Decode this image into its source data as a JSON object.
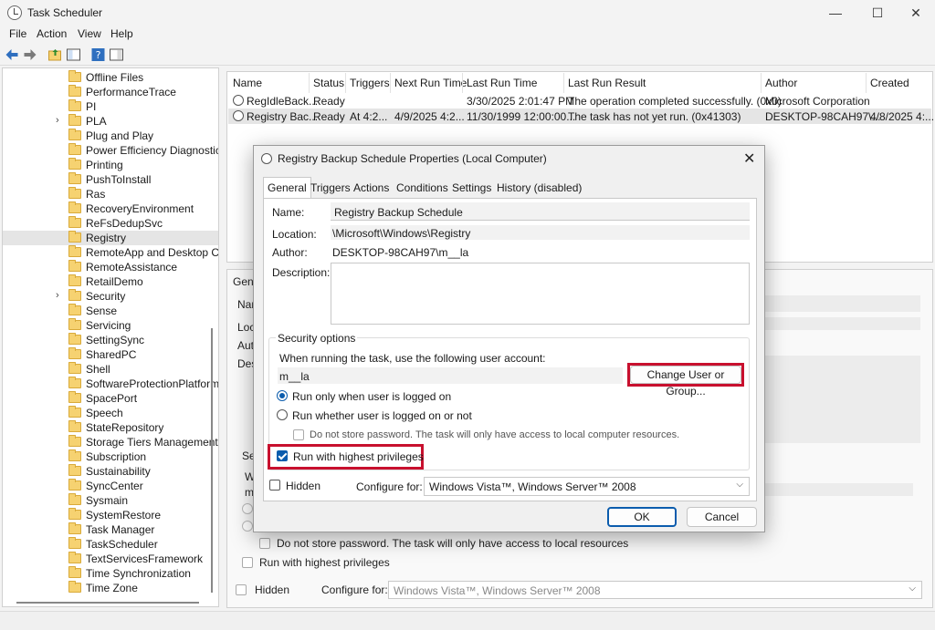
{
  "window": {
    "title": "Task Scheduler"
  },
  "window_controls": {
    "minimize": "—",
    "maximize": "☐",
    "close": "✕"
  },
  "menu": [
    "File",
    "Action",
    "View",
    "Help"
  ],
  "tree": {
    "selected": "Registry",
    "items": [
      {
        "label": "Offline Files",
        "expandable": false
      },
      {
        "label": "PerformanceTrace",
        "expandable": false
      },
      {
        "label": "PI",
        "expandable": false
      },
      {
        "label": "PLA",
        "expandable": true
      },
      {
        "label": "Plug and Play",
        "expandable": false
      },
      {
        "label": "Power Efficiency Diagnostics",
        "expandable": false
      },
      {
        "label": "Printing",
        "expandable": false
      },
      {
        "label": "PushToInstall",
        "expandable": false
      },
      {
        "label": "Ras",
        "expandable": false
      },
      {
        "label": "RecoveryEnvironment",
        "expandable": false
      },
      {
        "label": "ReFsDedupSvc",
        "expandable": false
      },
      {
        "label": "Registry",
        "expandable": false
      },
      {
        "label": "RemoteApp and Desktop Co",
        "expandable": false
      },
      {
        "label": "RemoteAssistance",
        "expandable": false
      },
      {
        "label": "RetailDemo",
        "expandable": false
      },
      {
        "label": "Security",
        "expandable": true
      },
      {
        "label": "Sense",
        "expandable": false
      },
      {
        "label": "Servicing",
        "expandable": false
      },
      {
        "label": "SettingSync",
        "expandable": false
      },
      {
        "label": "SharedPC",
        "expandable": false
      },
      {
        "label": "Shell",
        "expandable": false
      },
      {
        "label": "SoftwareProtectionPlatform",
        "expandable": false
      },
      {
        "label": "SpacePort",
        "expandable": false
      },
      {
        "label": "Speech",
        "expandable": false
      },
      {
        "label": "StateRepository",
        "expandable": false
      },
      {
        "label": "Storage Tiers Management",
        "expandable": false
      },
      {
        "label": "Subscription",
        "expandable": false
      },
      {
        "label": "Sustainability",
        "expandable": false
      },
      {
        "label": "SyncCenter",
        "expandable": false
      },
      {
        "label": "Sysmain",
        "expandable": false
      },
      {
        "label": "SystemRestore",
        "expandable": false
      },
      {
        "label": "Task Manager",
        "expandable": false
      },
      {
        "label": "TaskScheduler",
        "expandable": false
      },
      {
        "label": "TextServicesFramework",
        "expandable": false
      },
      {
        "label": "Time Synchronization",
        "expandable": false
      },
      {
        "label": "Time Zone",
        "expandable": false
      }
    ]
  },
  "task_list": {
    "columns": [
      "Name",
      "Status",
      "Triggers",
      "Next Run Time",
      "Last Run Time",
      "Last Run Result",
      "Author",
      "Created"
    ],
    "rows": [
      [
        "RegIdleBack...",
        "Ready",
        "",
        "",
        "3/30/2025 2:01:47 PM",
        "The operation completed successfully. (0x0)",
        "Microsoft Corporation",
        ""
      ],
      [
        "Registry Bac...",
        "Ready",
        "At 4:2...",
        "4/9/2025 4:2...",
        "11/30/1999 12:00:00...",
        "The task has not yet run. (0x41303)",
        "DESKTOP-98CAH97\\...",
        "4/8/2025 4:..."
      ]
    ]
  },
  "background_pane": {
    "tab": "Gene",
    "labels": [
      "Nan",
      "Loc",
      "Aut",
      "Des",
      "Se",
      "W",
      "m"
    ],
    "no_store_password": "Do not store password.  The task will only have access to local resources",
    "highest_privileges": "Run with highest privileges",
    "hidden": "Hidden",
    "configure_for_label": "Configure for:",
    "configure_for_value": "Windows Vista™, Windows Server™ 2008"
  },
  "dialog": {
    "title": "Registry Backup Schedule Properties (Local Computer)",
    "tabs": [
      "General",
      "Triggers",
      "Actions",
      "Conditions",
      "Settings",
      "History (disabled)"
    ],
    "name_label": "Name:",
    "name_value": "Registry Backup Schedule",
    "location_label": "Location:",
    "location_value": "\\Microsoft\\Windows\\Registry",
    "author_label": "Author:",
    "author_value": "DESKTOP-98CAH97\\m__la",
    "description_label": "Description:",
    "description_value": "",
    "security": {
      "legend": "Security options",
      "account_prompt": "When running the task, use the following user account:",
      "account_value": "m__la",
      "change_button": "Change User or Group...",
      "radio_logged_on": "Run only when user is logged on",
      "radio_whether": "Run whether user is logged on or not",
      "no_store_password": "Do not store password.  The task will only have access to local computer resources.",
      "highest_privileges": "Run with highest privileges"
    },
    "hidden_label": "Hidden",
    "configure_for_label": "Configure for:",
    "configure_for_value": "Windows Vista™, Windows Server™ 2008",
    "ok": "OK",
    "cancel": "Cancel"
  },
  "colors": {
    "accent": "#0b5cad",
    "highlight": "#c8102e"
  }
}
